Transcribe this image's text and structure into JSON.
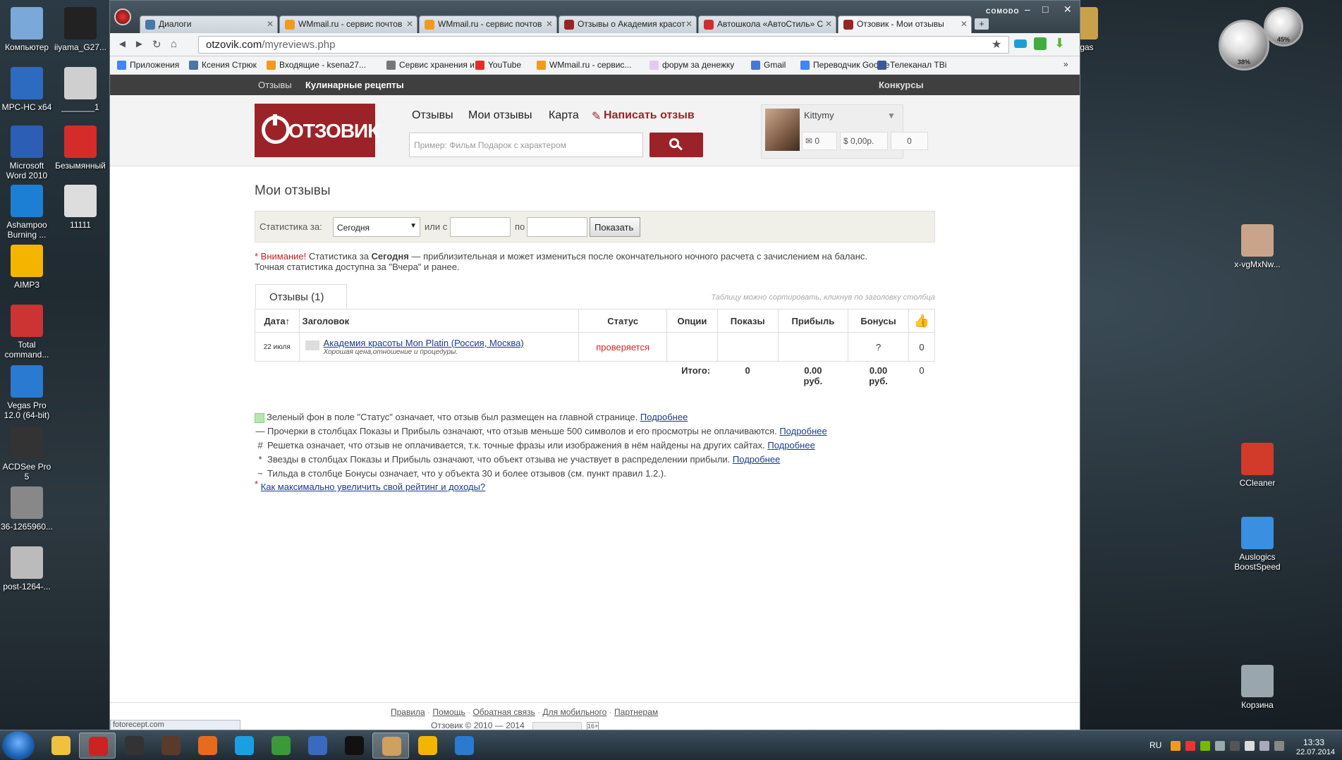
{
  "desktop_left": [
    {
      "label": "Компьютер",
      "color": "#7aa8d8"
    },
    {
      "label": "iiyama_G27...",
      "color": "#222"
    },
    {
      "label": "MPC-HC x64",
      "color": "#2d6bc0"
    },
    {
      "label": "_______1",
      "color": "#cfcfcf"
    },
    {
      "label": "Microsoft Word 2010",
      "color": "#2b5eb4"
    },
    {
      "label": "Безымянный",
      "color": "#d62b2b"
    },
    {
      "label": "Ashampoo Burning ...",
      "color": "#1d7fd4"
    },
    {
      "label": "11111",
      "color": "#ddd"
    },
    {
      "label": "AIMP3",
      "color": "#f4b400"
    },
    {
      "label": "Total command...",
      "color": "#c33"
    },
    {
      "label": "Vegas Pro 12.0 (64-bit)",
      "color": "#2a7ad1"
    },
    {
      "label": "ACDSee Pro 5",
      "color": "#333"
    },
    {
      "label": "36-1265960...",
      "color": "#888"
    },
    {
      "label": "post-1264-...",
      "color": "#bbb"
    }
  ],
  "desktop_right": [
    {
      "label": "Vegas",
      "color": "#c8a24a"
    },
    {
      "label": "x-vgMxNw...",
      "color": "#c9a48a"
    },
    {
      "label": "CCleaner",
      "color": "#d23a2a"
    },
    {
      "label": "Auslogics BoostSpeed",
      "color": "#3a8fe0"
    },
    {
      "label": "Корзина",
      "color": "#9aa6ae"
    }
  ],
  "gadgets": {
    "cpu": "38%",
    "mem": "45%"
  },
  "browser": {
    "brand": "COMODO",
    "tabs": [
      {
        "label": "Диалоги",
        "color": "#4a76a8"
      },
      {
        "label": "WMmail.ru - сервис почтов",
        "color": "#f29a1b"
      },
      {
        "label": "WMmail.ru - сервис почтов",
        "color": "#f29a1b"
      },
      {
        "label": "Отзывы о Академия красот",
        "color": "#9b2328"
      },
      {
        "label": "Автошкола «АвтоСтиль» С",
        "color": "#d42c2c"
      },
      {
        "label": "Отзовик - Мои отзывы",
        "color": "#9b2328"
      }
    ],
    "url_host": "otzovik.com",
    "url_path": "/myreviews.php",
    "bookmarks": [
      {
        "label": "Приложения",
        "color": "#4285f4"
      },
      {
        "label": "Ксения Стрюк",
        "color": "#4a76a8"
      },
      {
        "label": "Входящие - ksena27...",
        "color": "#f29a1b"
      },
      {
        "label": "Сервис хранения и...",
        "color": "#777"
      },
      {
        "label": "YouTube",
        "color": "#e52d27"
      },
      {
        "label": "WMmail.ru - сервис...",
        "color": "#f29a1b"
      },
      {
        "label": "форум за денежку",
        "color": "#e6c8f0"
      },
      {
        "label": "Gmail",
        "color": "#4a76d8"
      },
      {
        "label": "Переводчик Google",
        "color": "#4285f4"
      },
      {
        "label": "Телеканал ТВі",
        "color": "#3b5998"
      }
    ],
    "status_url": "fotorecept.com"
  },
  "site": {
    "topnav": {
      "reviews": "Отзывы",
      "recipes": "Кулинарные рецепты",
      "contests": "Конкурсы"
    },
    "logo": "ОТЗОВИК",
    "menu": {
      "reviews": "Отзывы",
      "my_reviews": "Мои отзывы",
      "map": "Карта",
      "write": "Написать отзыв"
    },
    "search_placeholder": "Пример: Фильм Подарок с характером",
    "user": {
      "name": "Kittymy",
      "messages": "0",
      "balance": "0,00р.",
      "points": "0"
    },
    "page_title": "Мои отзывы",
    "filter": {
      "label": "Статистика за:",
      "period": "Сегодня",
      "or_from": "или с",
      "to": "по",
      "button": "Показать"
    },
    "notice": {
      "star": "* Внимание!",
      "text1": " Статистика за ",
      "bold": "Сегодня",
      "text2": " — приблизительная и может измениться после окончательного ночного расчета с зачислением на баланс.",
      "line2": "Точная статистика доступна за \"Вчера\" и ранее."
    },
    "tab_label": "Отзывы (1)",
    "sort_hint": "Таблицу можно сортировать, кликнув по заголовку столбца",
    "columns": [
      "Дата↑",
      "Заголовок",
      "Статус",
      "Опции",
      "Показы",
      "Прибыль",
      "Бонусы",
      ""
    ],
    "rows": [
      {
        "date": "22 июля",
        "title": "Академия красоты Mon Platin (Россия, Москва)",
        "subtitle": "Хорошая цена,отношение и процедуры.",
        "status": "проверяется",
        "options": "",
        "views": "",
        "profit": "",
        "bonus": "?",
        "likes": "0"
      }
    ],
    "totals": {
      "label": "Итого:",
      "views": "0",
      "profit": "0.00",
      "profit_unit": "руб.",
      "bonus": "0.00",
      "bonus_unit": "руб.",
      "likes": "0"
    },
    "legend": [
      {
        "mark": "",
        "text": "Зеленый фон в поле \"Статус\" означает, что отзыв был размещен на главной странице.",
        "link": "Подробнее"
      },
      {
        "mark": "—",
        "text": "Прочерки в столбцах Показы и Прибыль означают, что отзыв меньше 500 символов и его просмотры не оплачиваются.",
        "link": "Подробнее"
      },
      {
        "mark": "#",
        "text": "Решетка означает, что отзыв не оплачивается, т.к. точные фразы или изображения в нём найдены на других сайтах.",
        "link": "Подробнее"
      },
      {
        "mark": "*",
        "text": "Звезды в столбцах Показы и Прибыль означают, что объект отзыва не участвует в распределении прибыли.",
        "link": "Подробнее"
      },
      {
        "mark": "~",
        "text": "Тильда в столбце Бонусы означает, что у объекта 30 и более отзывов (см. пункт правил 1.2.).",
        "link": ""
      }
    ],
    "rating_link": "Как максимально увеличить свой рейтинг и доходы?",
    "footer": {
      "links": [
        "Правила",
        "Помощь",
        "Обратная связь",
        "Для мобильного",
        "Партнерам"
      ],
      "copyright": "Отзовик © 2010 — 2014",
      "age": "16+"
    }
  },
  "taskbar": {
    "lang": "RU",
    "time": "13:33",
    "date": "22.07.2014"
  }
}
